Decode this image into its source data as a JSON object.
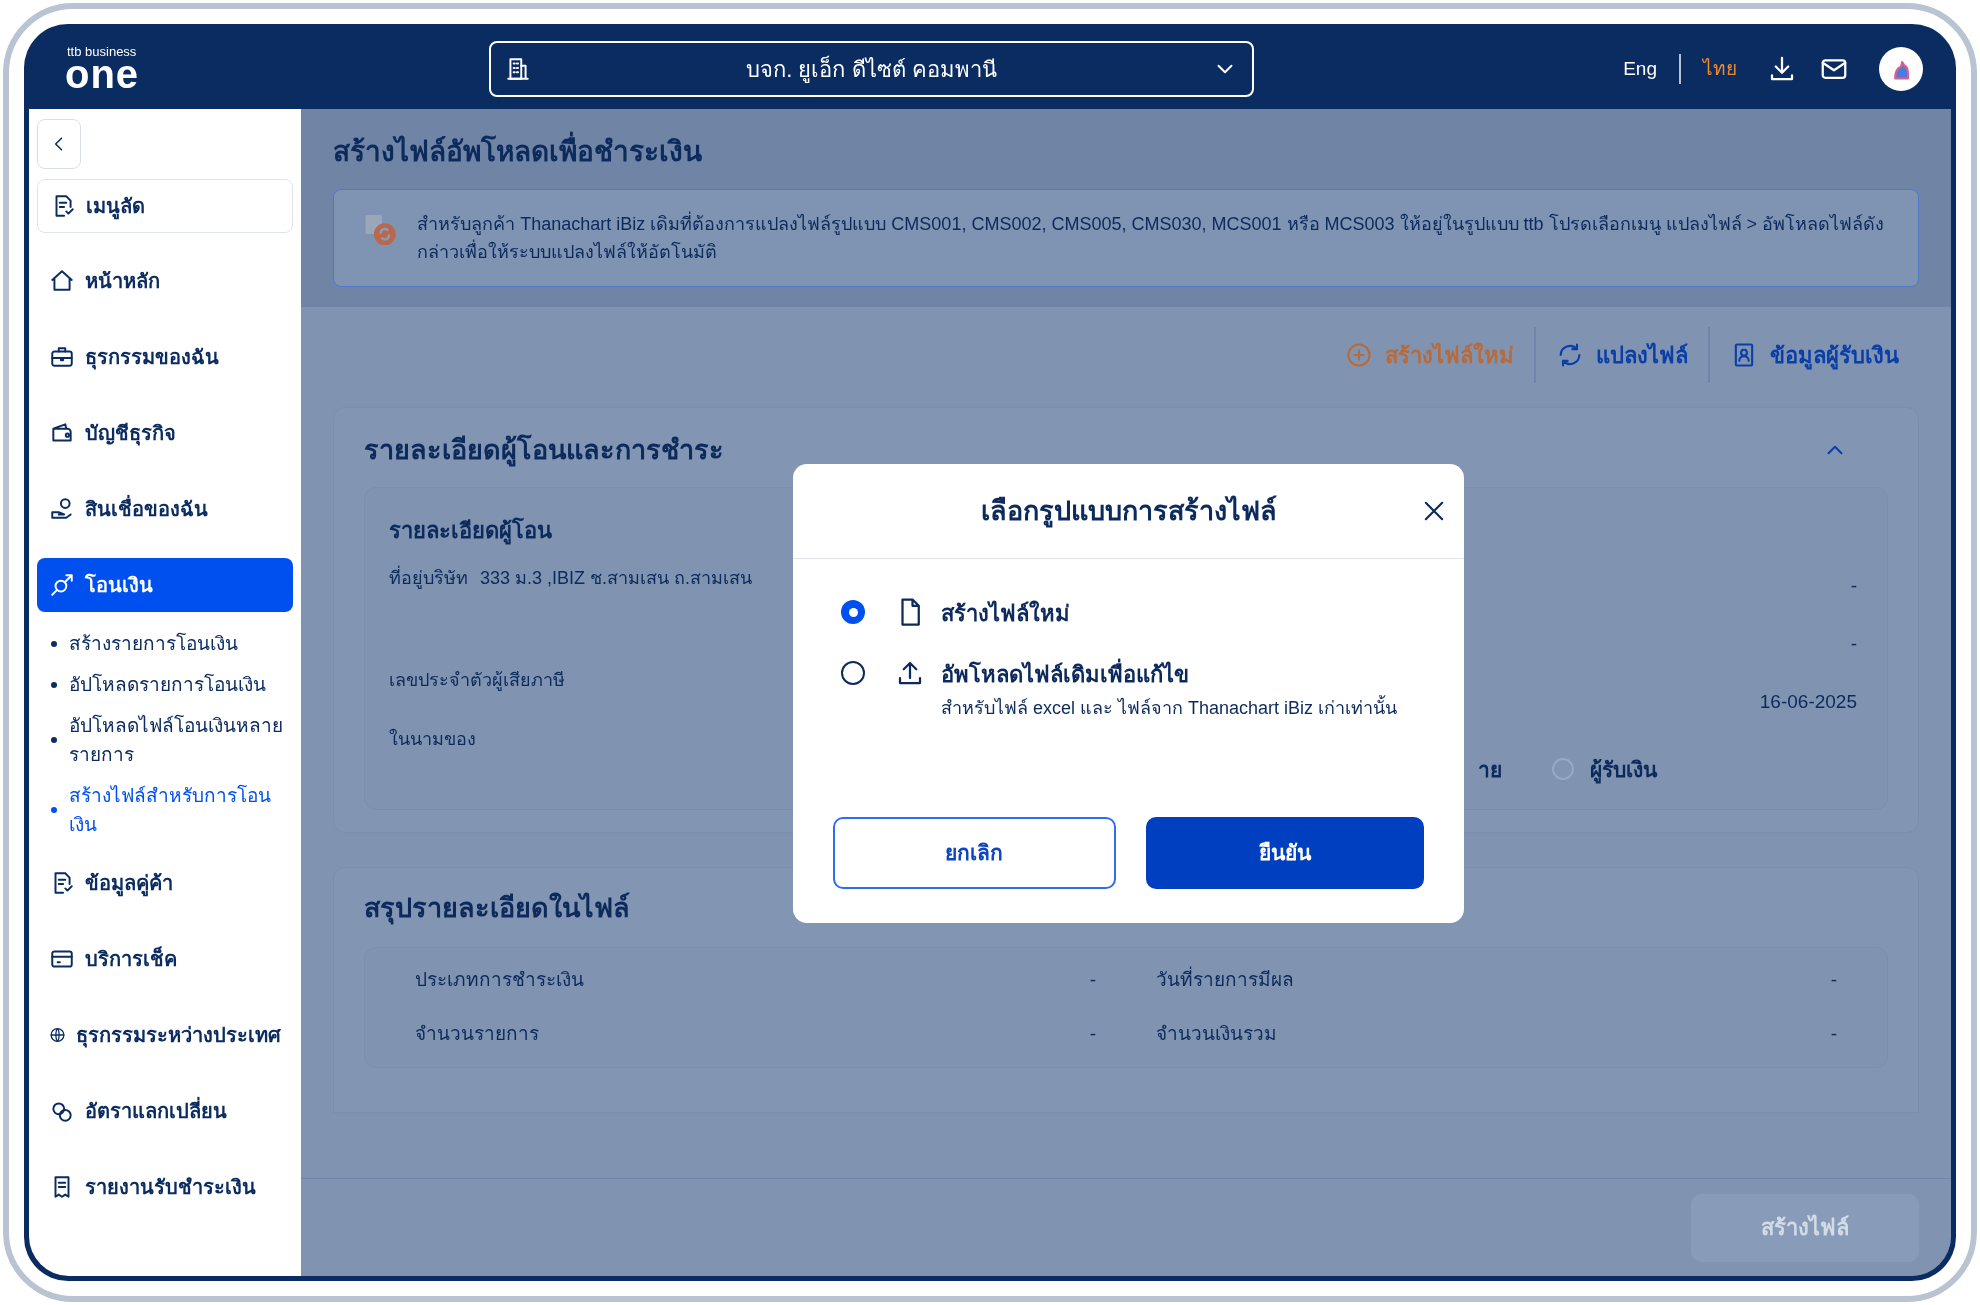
{
  "header": {
    "logo_top": "ttb business",
    "logo_main": "one",
    "company": "บจก. ยูเอ็ก ดีไซต์ คอมพานี",
    "languages": [
      {
        "label": "Eng",
        "selected": false
      },
      {
        "label": "ไทย",
        "selected": true
      }
    ]
  },
  "sidebar": {
    "items": [
      {
        "label": "เมนูลัด",
        "kind": "shortcut"
      },
      {
        "label": "หน้าหลัก",
        "kind": "menu",
        "selected": false
      },
      {
        "label": "ธุรกรรมของฉัน",
        "kind": "menu",
        "selected": false
      },
      {
        "label": "บัญชีธุรกิจ",
        "kind": "menu",
        "selected": false
      },
      {
        "label": "สินเชื่อของฉัน",
        "kind": "menu",
        "selected": false
      },
      {
        "label": "โอนเงิน",
        "kind": "menu",
        "selected": true,
        "children": [
          {
            "label": "สร้างรายการโอนเงิน",
            "selected": false
          },
          {
            "label": "อัปโหลดรายการโอนเงิน",
            "selected": false
          },
          {
            "label": "อัปโหลดไฟล์โอนเงินหลายรายการ",
            "selected": false
          },
          {
            "label": "สร้างไฟล์สำหรับการโอนเงิน",
            "selected": true
          }
        ]
      },
      {
        "label": "ข้อมูลคู่ค้า",
        "kind": "menu",
        "selected": false
      },
      {
        "label": "บริการเช็ค",
        "kind": "menu",
        "selected": false
      },
      {
        "label": "ธุรกรรมระหว่างประเทศ",
        "kind": "menu",
        "selected": false
      },
      {
        "label": "อัตราแลกเปลี่ยน",
        "kind": "menu",
        "selected": false
      },
      {
        "label": "รายงานรับชำระเงิน",
        "kind": "menu",
        "selected": false
      }
    ]
  },
  "page": {
    "title": "สร้างไฟล์อัพโหลดเพื่อชำระเงิน",
    "notice": "สำหรับลูกค้า Thanachart iBiz เดิมที่ต้องการแปลงไฟล์รูปแบบ CMS001, CMS002, CMS005, CMS030, MCS001 หรือ MCS003 ให้อยู่ในรูปแบบ ttb โปรดเลือกเมนู แปลงไฟล์ > อัพโหลดไฟล์ดังกล่าวเพื่อให้ระบบแปลงไฟล์ให้อัตโนมัติ",
    "actions": [
      {
        "label": "สร้างไฟล์ใหม่",
        "selected": true
      },
      {
        "label": "แปลงไฟล์",
        "selected": false
      },
      {
        "label": "ข้อมูลผู้รับเงิน",
        "selected": false
      }
    ]
  },
  "sender_section": {
    "title": "รายละเอียดผู้โอนและการชำระ",
    "expanded": true,
    "subtitle": "รายละเอียดผู้โอน",
    "fields": [
      {
        "label": "ที่อยู่บริษัท",
        "value": "333 ม.3 ,IBIZ ช.สามเสน ถ.สามเสน"
      },
      {
        "label": "เลขประจำตัวผู้เสียภาษี"
      },
      {
        "label": "ในนามของ"
      }
    ],
    "right_values": [
      "-",
      "-",
      "16-06-2025"
    ],
    "options": [
      {
        "label": "าย"
      },
      {
        "label": "ผู้รับเงิน",
        "selected": false
      }
    ]
  },
  "summary_section": {
    "title": "สรุปรายละเอียดในไฟล์",
    "fields": [
      {
        "label": "ประเภทการชำระเงิน",
        "value": "-"
      },
      {
        "label": "วันที่รายการมีผล",
        "value": "-"
      },
      {
        "label": "จำนวนรายการ",
        "value": "-"
      },
      {
        "label": "จำนวนเงินรวม",
        "value": "-"
      }
    ]
  },
  "footer": {
    "button": {
      "label": "สร้างไฟล์",
      "disabled": true
    }
  },
  "modal": {
    "title": "เลือกรูปแบบการสร้างไฟล์",
    "options": [
      {
        "label": "สร้างไฟล์ใหม่",
        "kind": "new",
        "selected": true
      },
      {
        "label": "อัพโหลดไฟล์เดิมเพื่อแก้ไข",
        "kind": "upload",
        "description": "สำหรับไฟล์ excel และ ไฟล์จาก Thanachart iBiz เก่าเท่านั้น",
        "selected": false
      }
    ],
    "cancel": "ยกเลิก",
    "confirm": "ยืนยัน"
  }
}
